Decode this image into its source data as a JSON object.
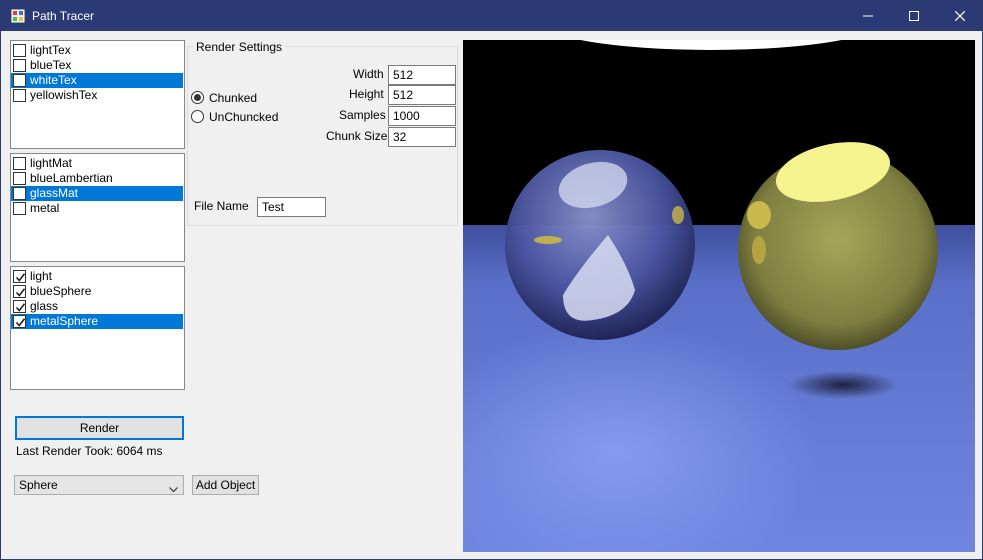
{
  "window": {
    "title": "Path Tracer"
  },
  "textures": {
    "items": [
      {
        "label": "lightTex",
        "checked": false,
        "selected": false
      },
      {
        "label": "blueTex",
        "checked": false,
        "selected": false
      },
      {
        "label": "whiteTex",
        "checked": false,
        "selected": true
      },
      {
        "label": "yellowishTex",
        "checked": false,
        "selected": false
      }
    ]
  },
  "materials": {
    "items": [
      {
        "label": "lightMat",
        "checked": false,
        "selected": false
      },
      {
        "label": "blueLambertian",
        "checked": false,
        "selected": false
      },
      {
        "label": "glassMat",
        "checked": false,
        "selected": true
      },
      {
        "label": "metal",
        "checked": false,
        "selected": false
      }
    ]
  },
  "objects": {
    "items": [
      {
        "label": "light",
        "checked": true,
        "selected": false
      },
      {
        "label": "blueSphere",
        "checked": true,
        "selected": false
      },
      {
        "label": "glass",
        "checked": true,
        "selected": false
      },
      {
        "label": "metalSphere",
        "checked": true,
        "selected": true
      }
    ]
  },
  "render_settings": {
    "title": "Render Settings",
    "mode_chunked": "Chunked",
    "mode_unchunked": "UnChuncked",
    "selected_mode": "chunked",
    "width_label": "Width",
    "width_value": "512",
    "height_label": "Height",
    "height_value": "512",
    "samples_label": "Samples",
    "samples_value": "1000",
    "chunk_label": "Chunk Size",
    "chunk_value": "32",
    "filename_label": "File Name",
    "filename_value": "Test"
  },
  "actions": {
    "render_label": "Render",
    "last_render": "Last Render Took: 6064 ms",
    "object_type": "Sphere",
    "add_object_label": "Add Object"
  },
  "colors": {
    "titlebar": "#2b3a75",
    "selection": "#0078d7",
    "floor": "#6a7fd8",
    "yellow_sphere": "#d8d87a"
  }
}
